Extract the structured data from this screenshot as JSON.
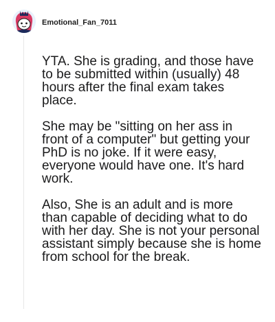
{
  "comment": {
    "author": "Emotional_Fan_7011",
    "avatar_icon": "snoo-avatar-icon",
    "paragraphs": [
      "YTA. She is grading, and those have to be submitted within (usually) 48 hours after the final exam takes place.",
      "She may be \"sitting on her ass in front of a computer\" but getting your PhD is no joke. If it were easy, everyone would have one. It's hard work.",
      "Also, She is an adult and is more than capable of deciding what to do with her day. She is not your personal assistant simply because she is home from school for the break."
    ]
  },
  "colors": {
    "text": "#1a1a1b",
    "thread_line": "#e6e6e6",
    "avatar_background": "#e8f0fb",
    "avatar_accent": "#d93a63"
  }
}
